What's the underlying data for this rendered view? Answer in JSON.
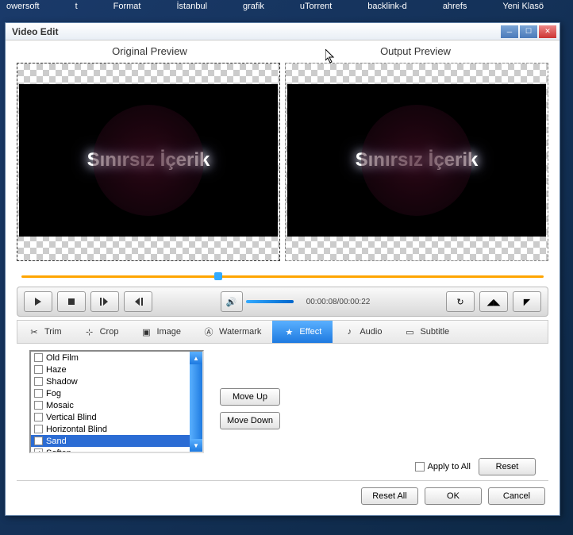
{
  "desktop": {
    "icons": [
      "owersoft",
      "t",
      "Format",
      "İstanbul",
      "grafik",
      "uTorrent",
      "backlink-d",
      "ahrefs",
      "Yeni Klasö"
    ]
  },
  "window": {
    "title": "Video Edit"
  },
  "preview": {
    "original_label": "Original Preview",
    "output_label": "Output Preview",
    "content_text": "Sınırsız İçerik"
  },
  "time": "00:00:08/00:00:22",
  "tabs": {
    "trim": "Trim",
    "crop": "Crop",
    "image": "Image",
    "watermark": "Watermark",
    "effect": "Effect",
    "audio": "Audio",
    "subtitle": "Subtitle"
  },
  "effects": [
    {
      "label": "Old Film",
      "checked": false,
      "selected": false
    },
    {
      "label": "Haze",
      "checked": false,
      "selected": false
    },
    {
      "label": "Shadow",
      "checked": false,
      "selected": false
    },
    {
      "label": "Fog",
      "checked": false,
      "selected": false
    },
    {
      "label": "Mosaic",
      "checked": false,
      "selected": false
    },
    {
      "label": "Vertical Blind",
      "checked": false,
      "selected": false
    },
    {
      "label": "Horizontal Blind",
      "checked": false,
      "selected": false
    },
    {
      "label": "Sand",
      "checked": false,
      "selected": true
    },
    {
      "label": "Soften",
      "checked": true,
      "selected": false
    }
  ],
  "buttons": {
    "move_up": "Move Up",
    "move_down": "Move Down",
    "apply_all": "Apply to All",
    "reset": "Reset",
    "reset_all": "Reset All",
    "ok": "OK",
    "cancel": "Cancel"
  }
}
